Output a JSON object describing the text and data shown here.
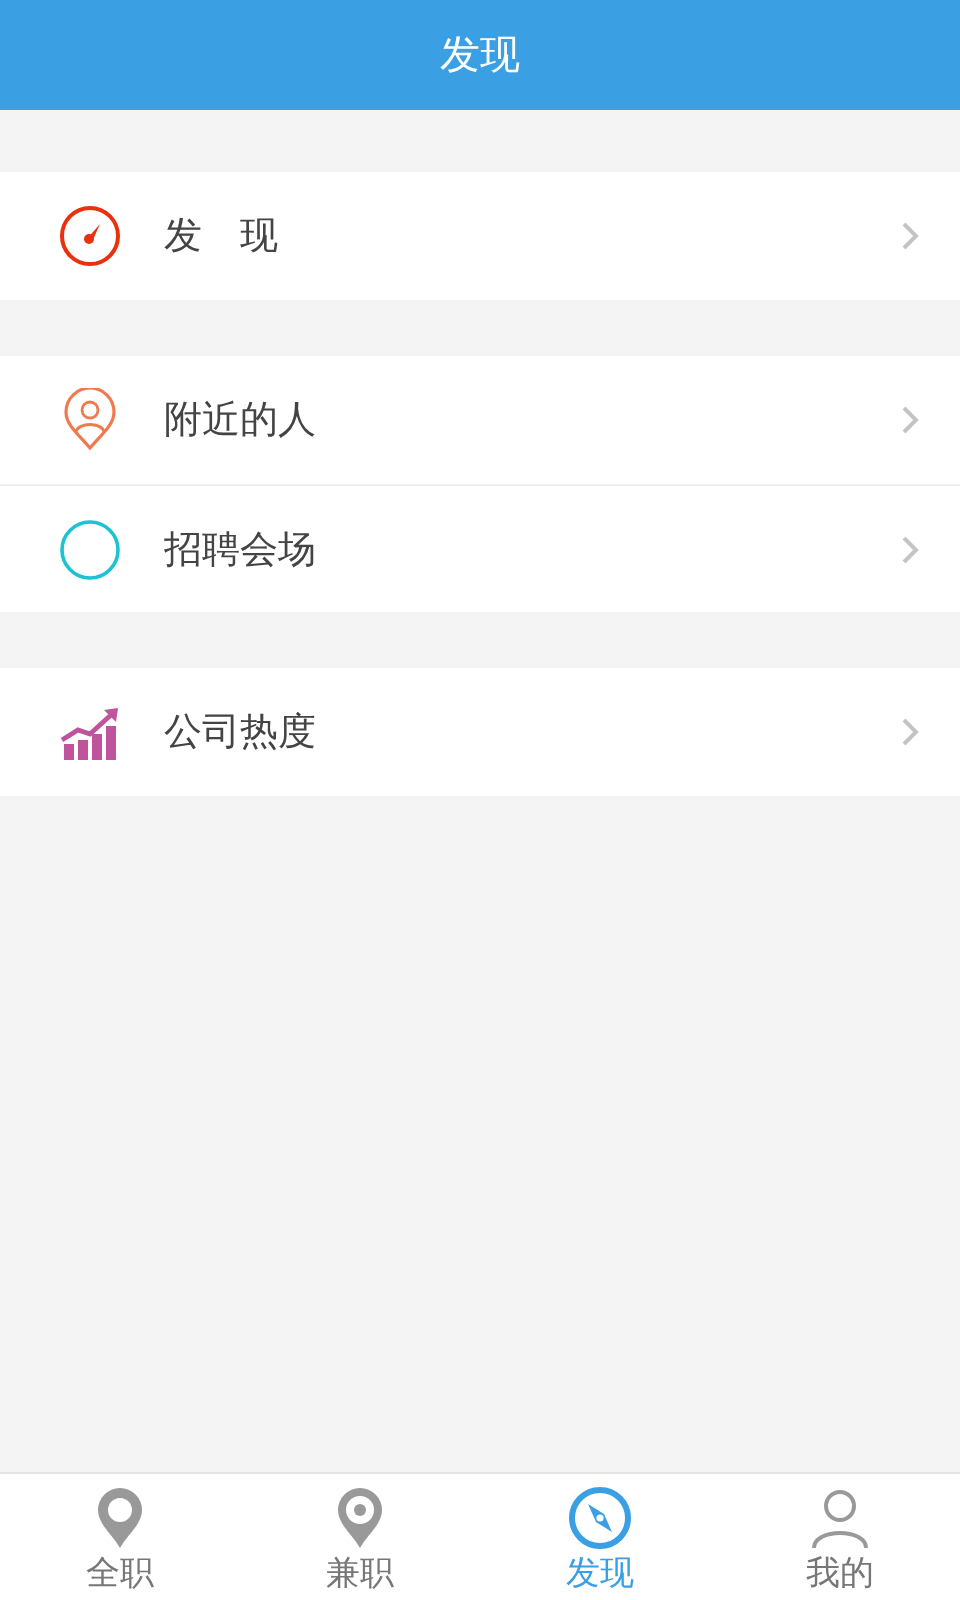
{
  "header": {
    "title": "发现"
  },
  "sections": [
    {
      "items": [
        {
          "kind": "gauge",
          "label": "发　现",
          "color": "#e8320e"
        }
      ]
    },
    {
      "items": [
        {
          "kind": "person-pin",
          "label": "附近的人",
          "color": "#f07a4e"
        },
        {
          "kind": "ring",
          "label": "招聘会场",
          "color": "#1bc3d3"
        }
      ]
    },
    {
      "items": [
        {
          "kind": "chart",
          "label": "公司热度",
          "color": "#c0549c"
        }
      ]
    }
  ],
  "tabs": [
    {
      "kind": "pin",
      "label": "全职",
      "selected": false
    },
    {
      "kind": "pin-dot",
      "label": "兼职",
      "selected": false
    },
    {
      "kind": "compass",
      "label": "发现",
      "selected": true
    },
    {
      "kind": "user",
      "label": "我的",
      "selected": false
    }
  ]
}
